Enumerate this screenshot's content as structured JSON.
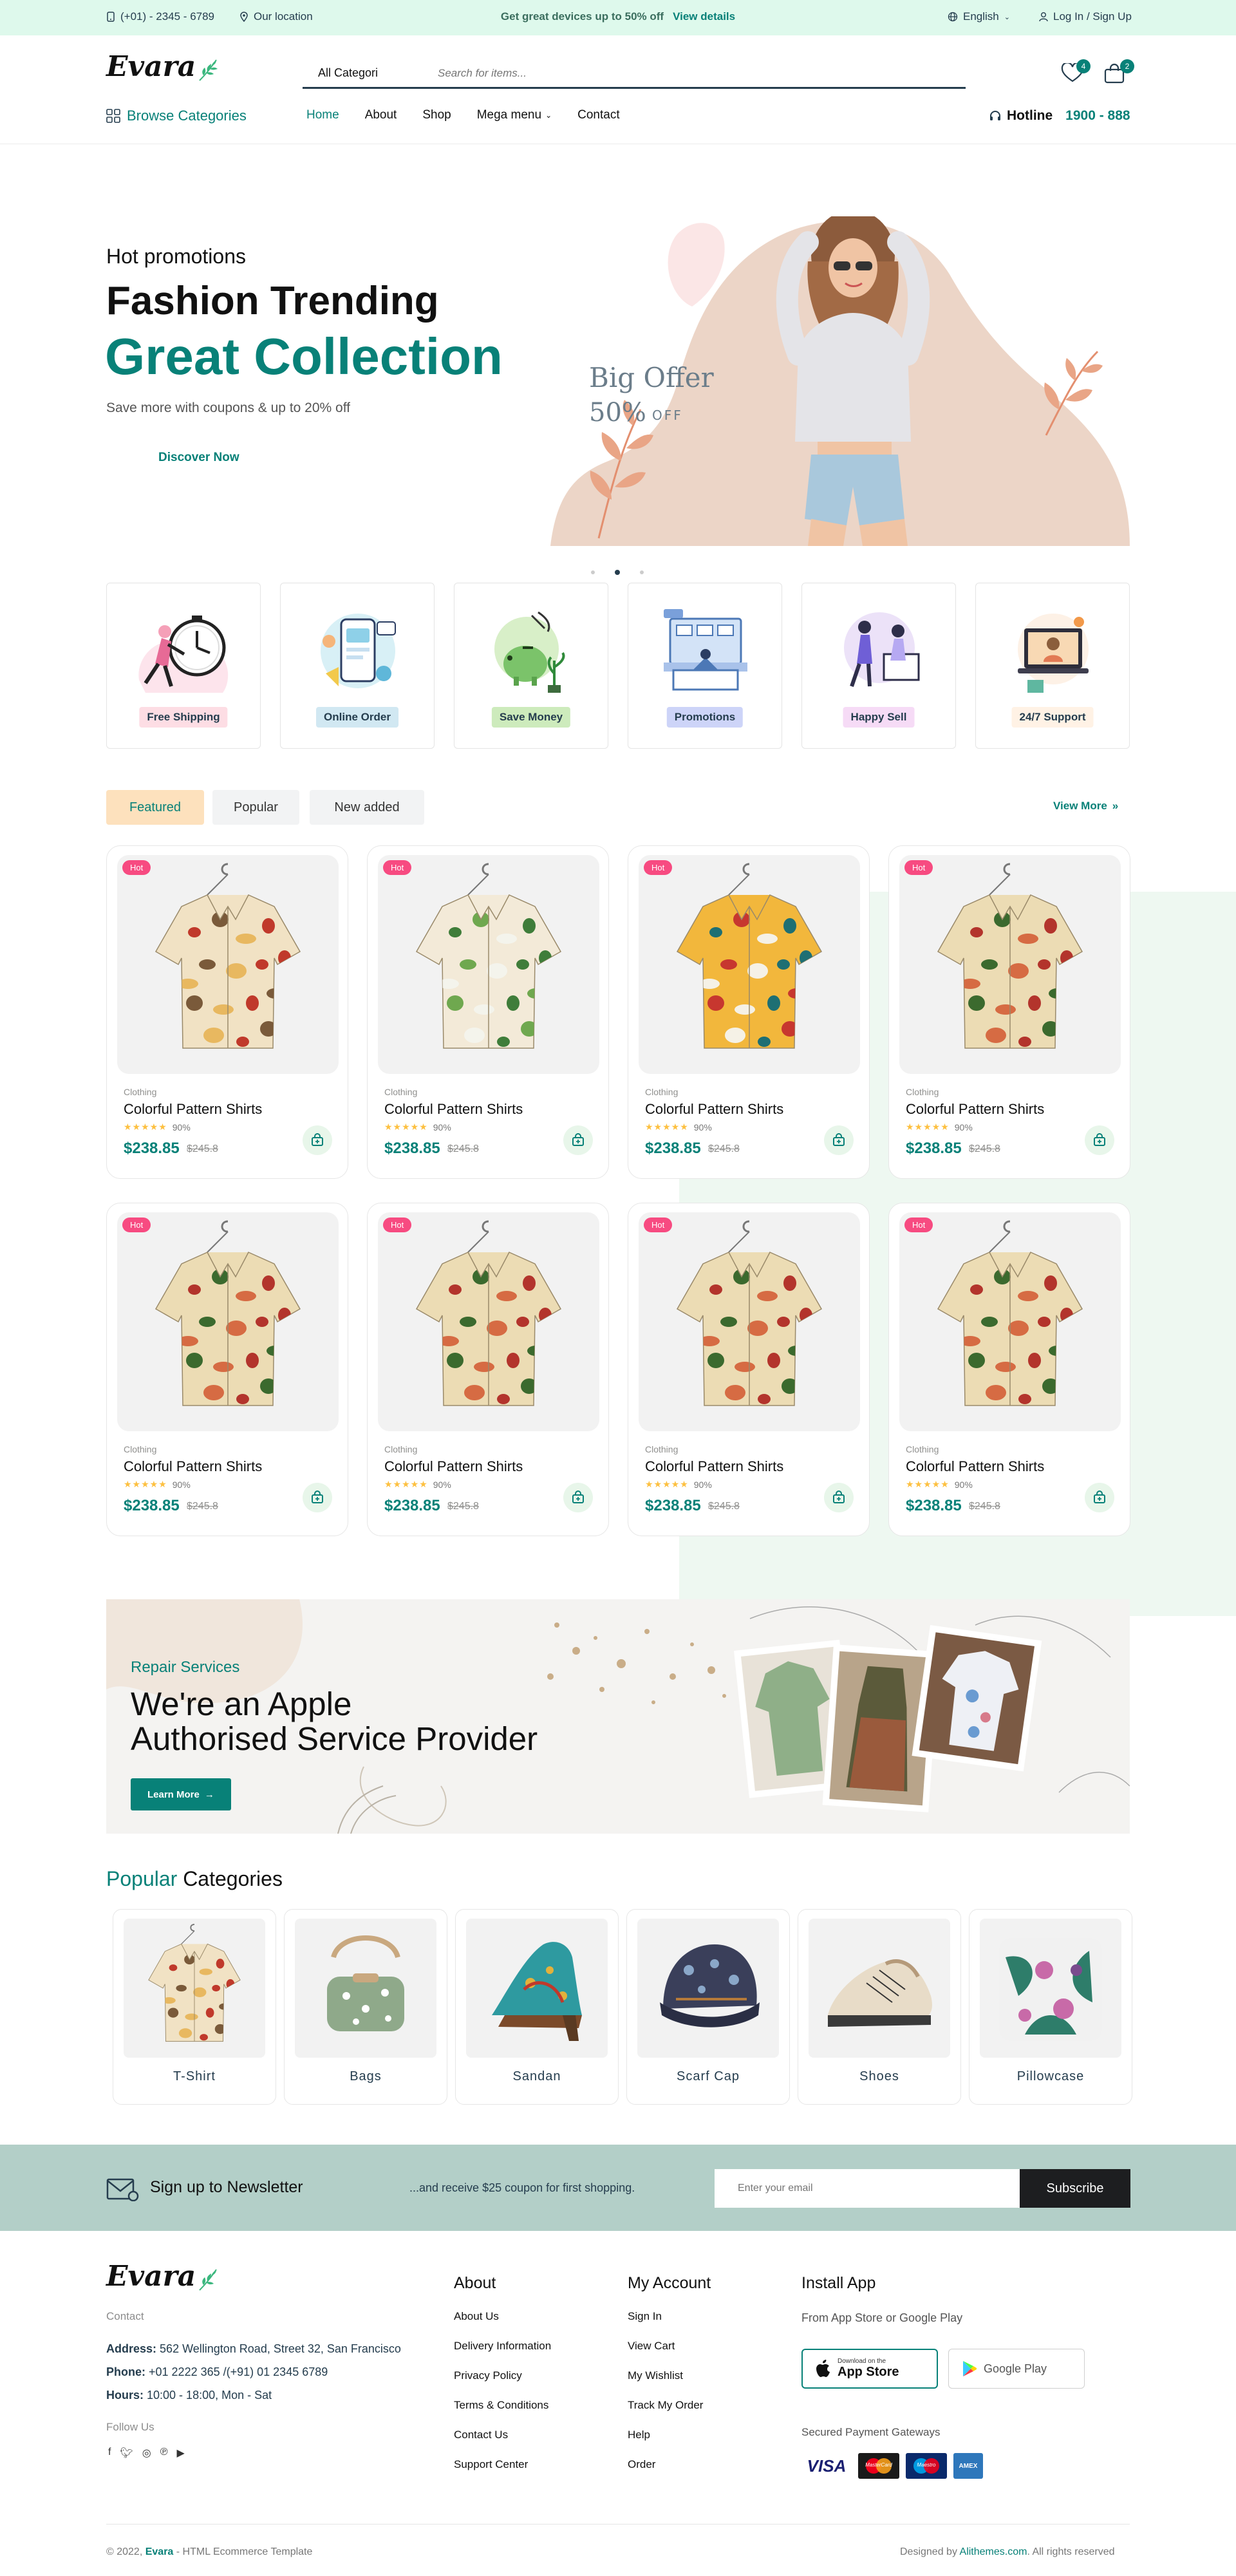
{
  "topbar": {
    "phone": "(+01) - 2345 - 6789",
    "location": "Our location",
    "promo_text": "Get great devices up to 50% off",
    "promo_link": "View details",
    "language": "English",
    "auth": "Log In / Sign Up"
  },
  "header": {
    "logo": "Evara",
    "search_category": "All Categori",
    "search_placeholder": "Search for items...",
    "wishlist_count": "4",
    "cart_count": "2",
    "browse_categories": "Browse Categories",
    "nav": [
      "Home",
      "About",
      "Shop",
      "Mega menu",
      "Contact"
    ],
    "hotline_label": "Hotline",
    "hotline_number": "1900 - 888"
  },
  "hero": {
    "subtitle": "Hot promotions",
    "title_line1": "Fashion Trending",
    "title_line2": "Great Collection",
    "description": "Save more with coupons & up to 20% off",
    "button": "Discover Now",
    "offer_title": "Big Offer",
    "offer_percent": "50%",
    "offer_suffix": "OFF"
  },
  "features": [
    {
      "label": "Free Shipping",
      "bg": "#fddde4",
      "icon": "clock-runner-icon"
    },
    {
      "label": "Online Order",
      "bg": "#d1e8f2",
      "icon": "online-order-icon"
    },
    {
      "label": "Save Money",
      "bg": "#cdebbc",
      "icon": "piggy-bank-icon"
    },
    {
      "label": "Promotions",
      "bg": "#cdd4f8",
      "icon": "promotions-icon"
    },
    {
      "label": "Happy Sell",
      "bg": "#f6dbf6",
      "icon": "happy-sell-icon"
    },
    {
      "label": "24/7 Support",
      "bg": "#fff2e5",
      "icon": "support-icon"
    }
  ],
  "tabs": [
    "Featured",
    "Popular",
    "New added"
  ],
  "view_more": "View More",
  "products": [
    {
      "badge": "Hot",
      "category": "Clothing",
      "name": "Colorful Pattern Shirts",
      "rating": "90%",
      "price": "$238.85",
      "old_price": "$245.8",
      "shirt": "mushroom"
    },
    {
      "badge": "Hot",
      "category": "Clothing",
      "name": "Colorful Pattern Shirts",
      "rating": "90%",
      "price": "$238.85",
      "old_price": "$245.8",
      "shirt": "tropical"
    },
    {
      "badge": "Hot",
      "category": "Clothing",
      "name": "Colorful Pattern Shirts",
      "rating": "90%",
      "price": "$238.85",
      "old_price": "$245.8",
      "shirt": "abstract"
    },
    {
      "badge": "Hot",
      "category": "Clothing",
      "name": "Colorful Pattern Shirts",
      "rating": "90%",
      "price": "$238.85",
      "old_price": "$245.8",
      "shirt": "floral"
    },
    {
      "badge": "Hot",
      "category": "Clothing",
      "name": "Colorful Pattern Shirts",
      "rating": "90%",
      "price": "$238.85",
      "old_price": "$245.8",
      "shirt": "floral"
    },
    {
      "badge": "Hot",
      "category": "Clothing",
      "name": "Colorful Pattern Shirts",
      "rating": "90%",
      "price": "$238.85",
      "old_price": "$245.8",
      "shirt": "floral"
    },
    {
      "badge": "Hot",
      "category": "Clothing",
      "name": "Colorful Pattern Shirts",
      "rating": "90%",
      "price": "$238.85",
      "old_price": "$245.8",
      "shirt": "floral"
    },
    {
      "badge": "Hot",
      "category": "Clothing",
      "name": "Colorful Pattern Shirts",
      "rating": "90%",
      "price": "$238.85",
      "old_price": "$245.8",
      "shirt": "floral"
    }
  ],
  "banner": {
    "kicker": "Repair Services",
    "title_line1": "We're an Apple",
    "title_line2": "Authorised Service Provider",
    "button": "Learn More"
  },
  "popular": {
    "title_accent": "Popular",
    "title_rest": "Categories",
    "items": [
      "T-Shirt",
      "Bags",
      "Sandan",
      "Scarf Cap",
      "Shoes",
      "Pillowcase"
    ]
  },
  "newsletter": {
    "title": "Sign up to Newsletter",
    "text": "...and receive $25 coupon for first shopping.",
    "placeholder": "Enter your email",
    "button": "Subscribe"
  },
  "footer": {
    "logo": "Evara",
    "contact_heading": "Contact",
    "address_label": "Address:",
    "address": "562 Wellington Road, Street 32, San Francisco",
    "phone_label": "Phone:",
    "phone": "+01 2222 365 /(+91) 01 2345 6789",
    "hours_label": "Hours:",
    "hours": "10:00 - 18:00, Mon - Sat",
    "follow": "Follow Us",
    "about_heading": "About",
    "about_links": [
      "About Us",
      "Delivery Information",
      "Privacy Policy",
      "Terms & Conditions",
      "Contact Us",
      "Support Center"
    ],
    "account_heading": "My Account",
    "account_links": [
      "Sign In",
      "View Cart",
      "My Wishlist",
      "Track My Order",
      "Help",
      "Order"
    ],
    "app_heading": "Install App",
    "app_sub": "From App Store or Google Play",
    "appstore_small": "Download on the",
    "appstore_big": "App Store",
    "googleplay": "Google Play",
    "payment_heading": "Secured Payment Gateways",
    "payments": [
      "VISA",
      "MasterCard",
      "Maestro",
      "AMEX"
    ],
    "copyright_prefix": "© 2022,",
    "copyright_brand": "Evara",
    "copyright_suffix": "- HTML Ecommerce Template",
    "designed_prefix": "Designed by",
    "designed_by": "Alithemes.com",
    "designed_suffix": ". All rights reserved"
  }
}
